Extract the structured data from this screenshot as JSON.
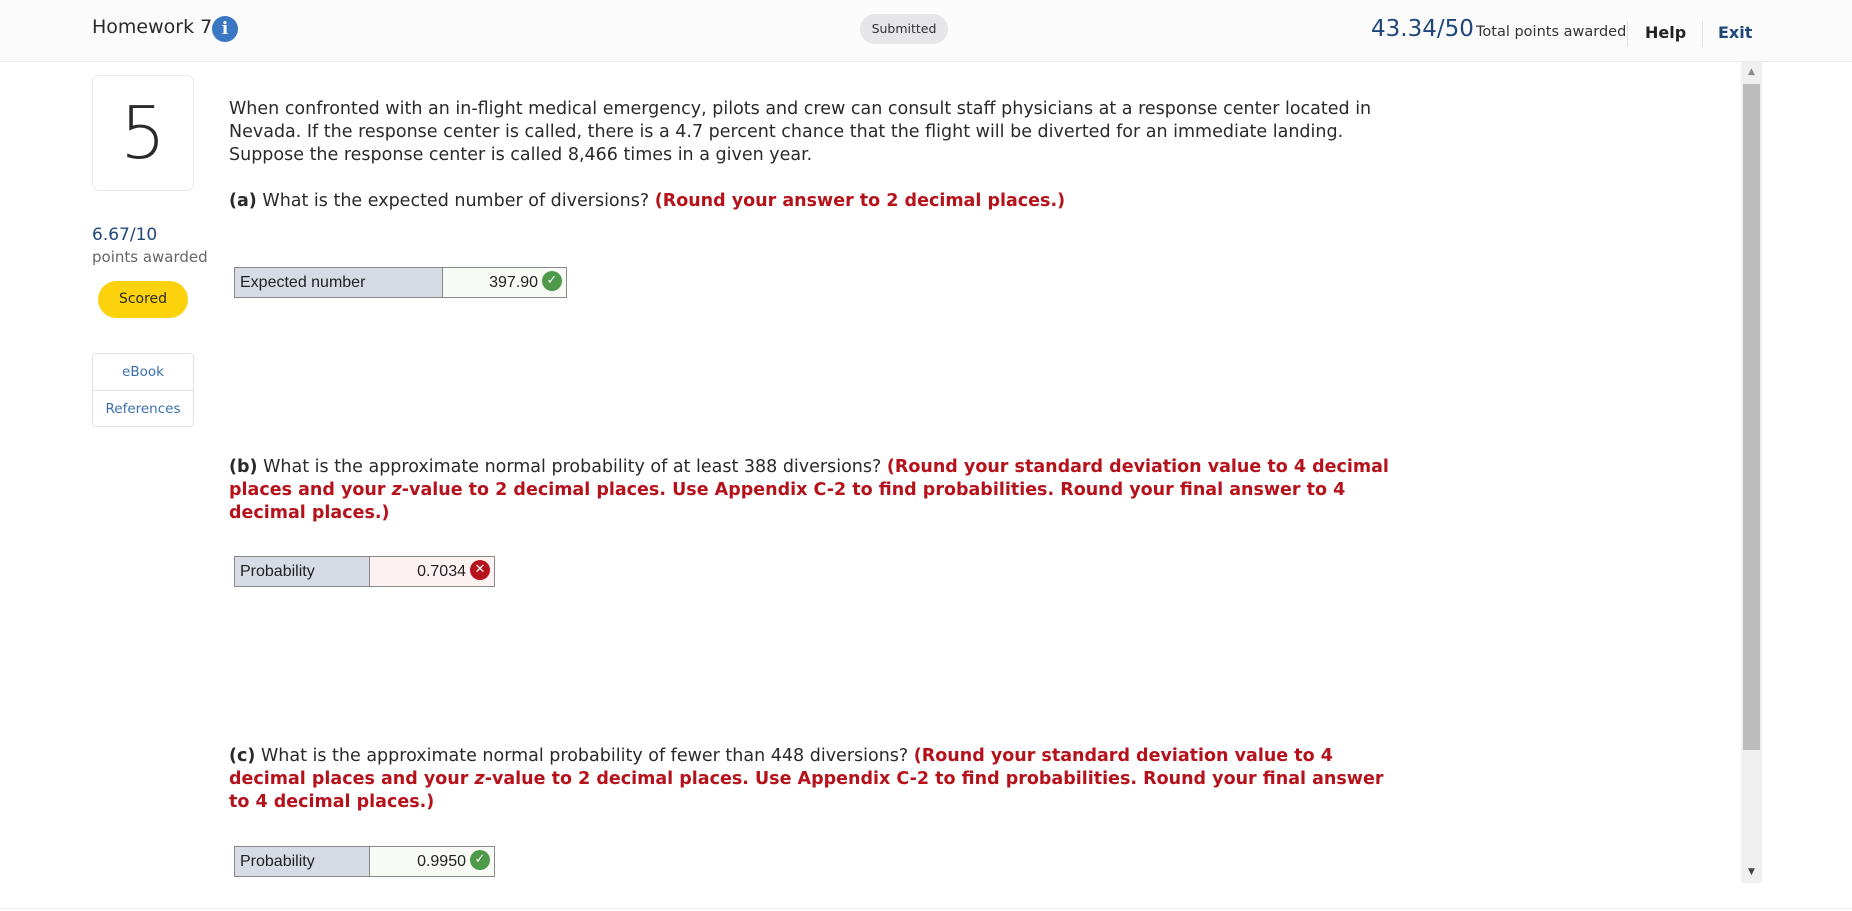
{
  "header": {
    "title": "Homework 7",
    "info_icon": "info-icon",
    "status_badge": "Submitted",
    "score": "43.34/50",
    "score_label": "Total points awarded",
    "help_label": "Help",
    "exit_label": "Exit"
  },
  "sidebar": {
    "question_number": "5",
    "points": "6.67/10",
    "points_label": "points awarded",
    "status": "Scored",
    "resources": [
      {
        "label": "eBook"
      },
      {
        "label": "References"
      }
    ]
  },
  "question": {
    "prompt": "When confronted with an in-flight medical emergency, pilots and crew can consult staff physicians at a response center located in Nevada. If the response center is called, there is a 4.7 percent chance that the flight will be diverted for an immediate landing. Suppose the response center is called 8,466 times in a given year.",
    "parts": [
      {
        "label": "(a)",
        "text": "What is the expected number of diversions?",
        "hint": "(Round your answer to 2 decimal places.)",
        "answer_label": "Expected number",
        "answer_value": "397.90",
        "result": "correct",
        "result_icon": "check-circle-icon"
      },
      {
        "label": "(b)",
        "text": "What is the approximate normal probability of at least 388 diversions?",
        "hint_pre": "(Round your standard deviation value to 4 decimal places and your ",
        "hint_italic": "z",
        "hint_post": "-value to 2 decimal places. Use Appendix C-2 to find probabilities. Round your final answer to 4 decimal places.)",
        "answer_label": "Probability",
        "answer_value": "0.7034",
        "result": "incorrect",
        "result_icon": "x-circle-icon"
      },
      {
        "label": "(c)",
        "text": "What is the approximate normal probability of fewer than 448 diversions?",
        "hint_pre": "(Round your standard deviation value to 4 decimal places and your ",
        "hint_italic": "z",
        "hint_post": "-value to 2 decimal places. Use Appendix C-2 to find probabilities. Round your final answer to 4 decimal places.)",
        "answer_label": "Probability",
        "answer_value": "0.9950",
        "result": "correct",
        "result_icon": "check-circle-icon"
      }
    ]
  },
  "colors": {
    "accent_blue": "#20477a",
    "hint_red": "#b5121b",
    "scored_yellow": "#fcd20d",
    "correct_green": "#4f9a4a"
  }
}
